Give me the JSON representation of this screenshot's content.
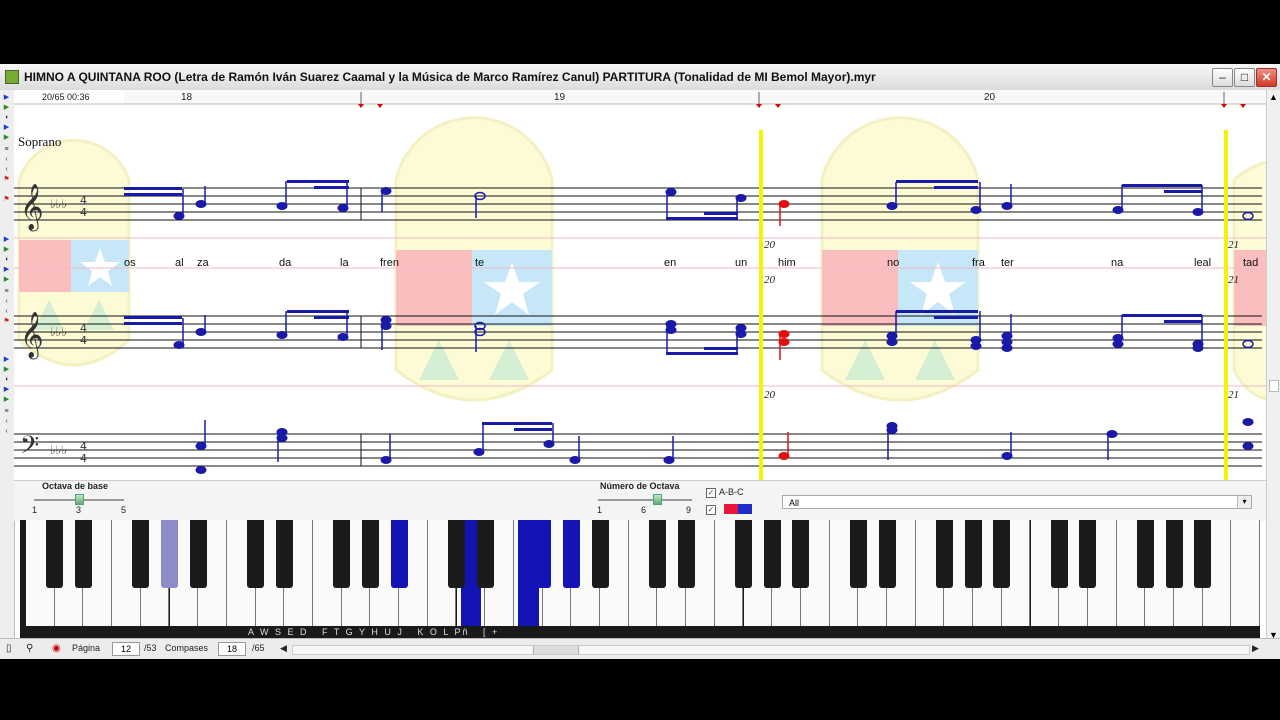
{
  "window": {
    "title": "HIMNO A QUINTANA ROO (Letra de Ramón Iván Suarez Caamal y la Música de Marco Ramírez Canul) PARTITURA (Tonalidad de MI Bemol Mayor).myr",
    "buttons": {
      "minimize": "–",
      "maximize": "□",
      "close": "✕"
    }
  },
  "score": {
    "position": "20/65 00:36",
    "measures": [
      "18",
      "19",
      "20"
    ],
    "voice_label": "Soprano",
    "measure_marks": [
      "20",
      "21",
      "20",
      "21",
      "20",
      "21"
    ],
    "lyrics": [
      "os",
      "al",
      "za",
      "da",
      "la",
      "fren",
      "te",
      "en",
      "un",
      "him",
      "no",
      "fra",
      "ter",
      "na",
      "leal",
      "tad"
    ]
  },
  "panel": {
    "base_octave_label": "Octava de base",
    "base_octave_ticks": [
      "1",
      "3",
      "5"
    ],
    "base_octave_value": 3,
    "octave_number_label": "Número de Octava",
    "octave_number_ticks": [
      "1",
      "6",
      "9"
    ],
    "octave_number_value": 6,
    "abc_label": "A-B-C",
    "abc_checked": "✓",
    "second_checked": "✓",
    "swatch_colors": [
      "#e8143a",
      "#1e2dc8"
    ],
    "filter_value": "All",
    "filter_arrow": "▾"
  },
  "keyboard": {
    "key_letters": "A W S E D   F T G Y H U J   K O L Pñ   [ +"
  },
  "status": {
    "page_label": "Página",
    "page_value": "12",
    "page_total": "/53",
    "measures_label": "Compases",
    "measures_value": "18",
    "measures_total": "/65"
  },
  "colors": {
    "note_blue": "#1a1aa8",
    "note_red": "#e01010",
    "playhead": "#f4f400",
    "key_active_dark": "#1414b4",
    "key_active_light": "#8c8cc8"
  }
}
